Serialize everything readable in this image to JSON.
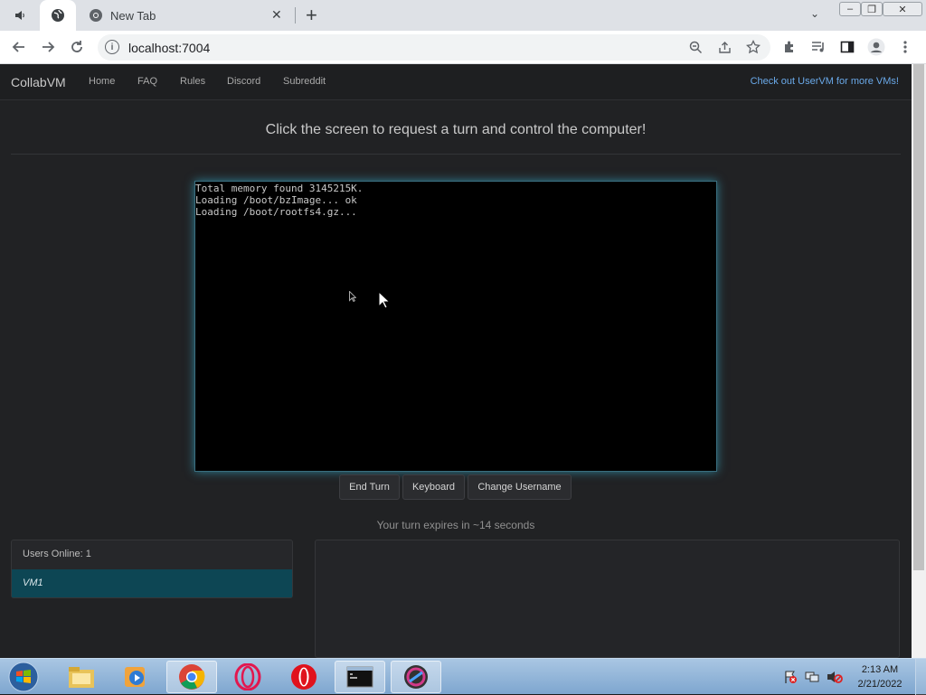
{
  "browser": {
    "tab": {
      "title": "New Tab"
    },
    "url": "localhost:7004"
  },
  "nav": {
    "brand": "CollabVM",
    "links": [
      "Home",
      "FAQ",
      "Rules",
      "Discord",
      "Subreddit"
    ],
    "promo": "Check out UserVM for more VMs!"
  },
  "main": {
    "headline": "Click the screen to request a turn and control the computer!",
    "console_lines": [
      "Total memory found 3145215K.",
      "Loading /boot/bzImage... ok",
      "Loading /boot/rootfs4.gz..."
    ],
    "buttons": {
      "end_turn": "End Turn",
      "keyboard": "Keyboard",
      "change_username": "Change Username"
    },
    "turn_status": "Your turn expires in ~14 seconds"
  },
  "users": {
    "header": "Users Online: 1",
    "list": [
      "VM1"
    ]
  },
  "taskbar": {
    "clock_time": "2:13 AM",
    "clock_date": "2/21/2022"
  }
}
